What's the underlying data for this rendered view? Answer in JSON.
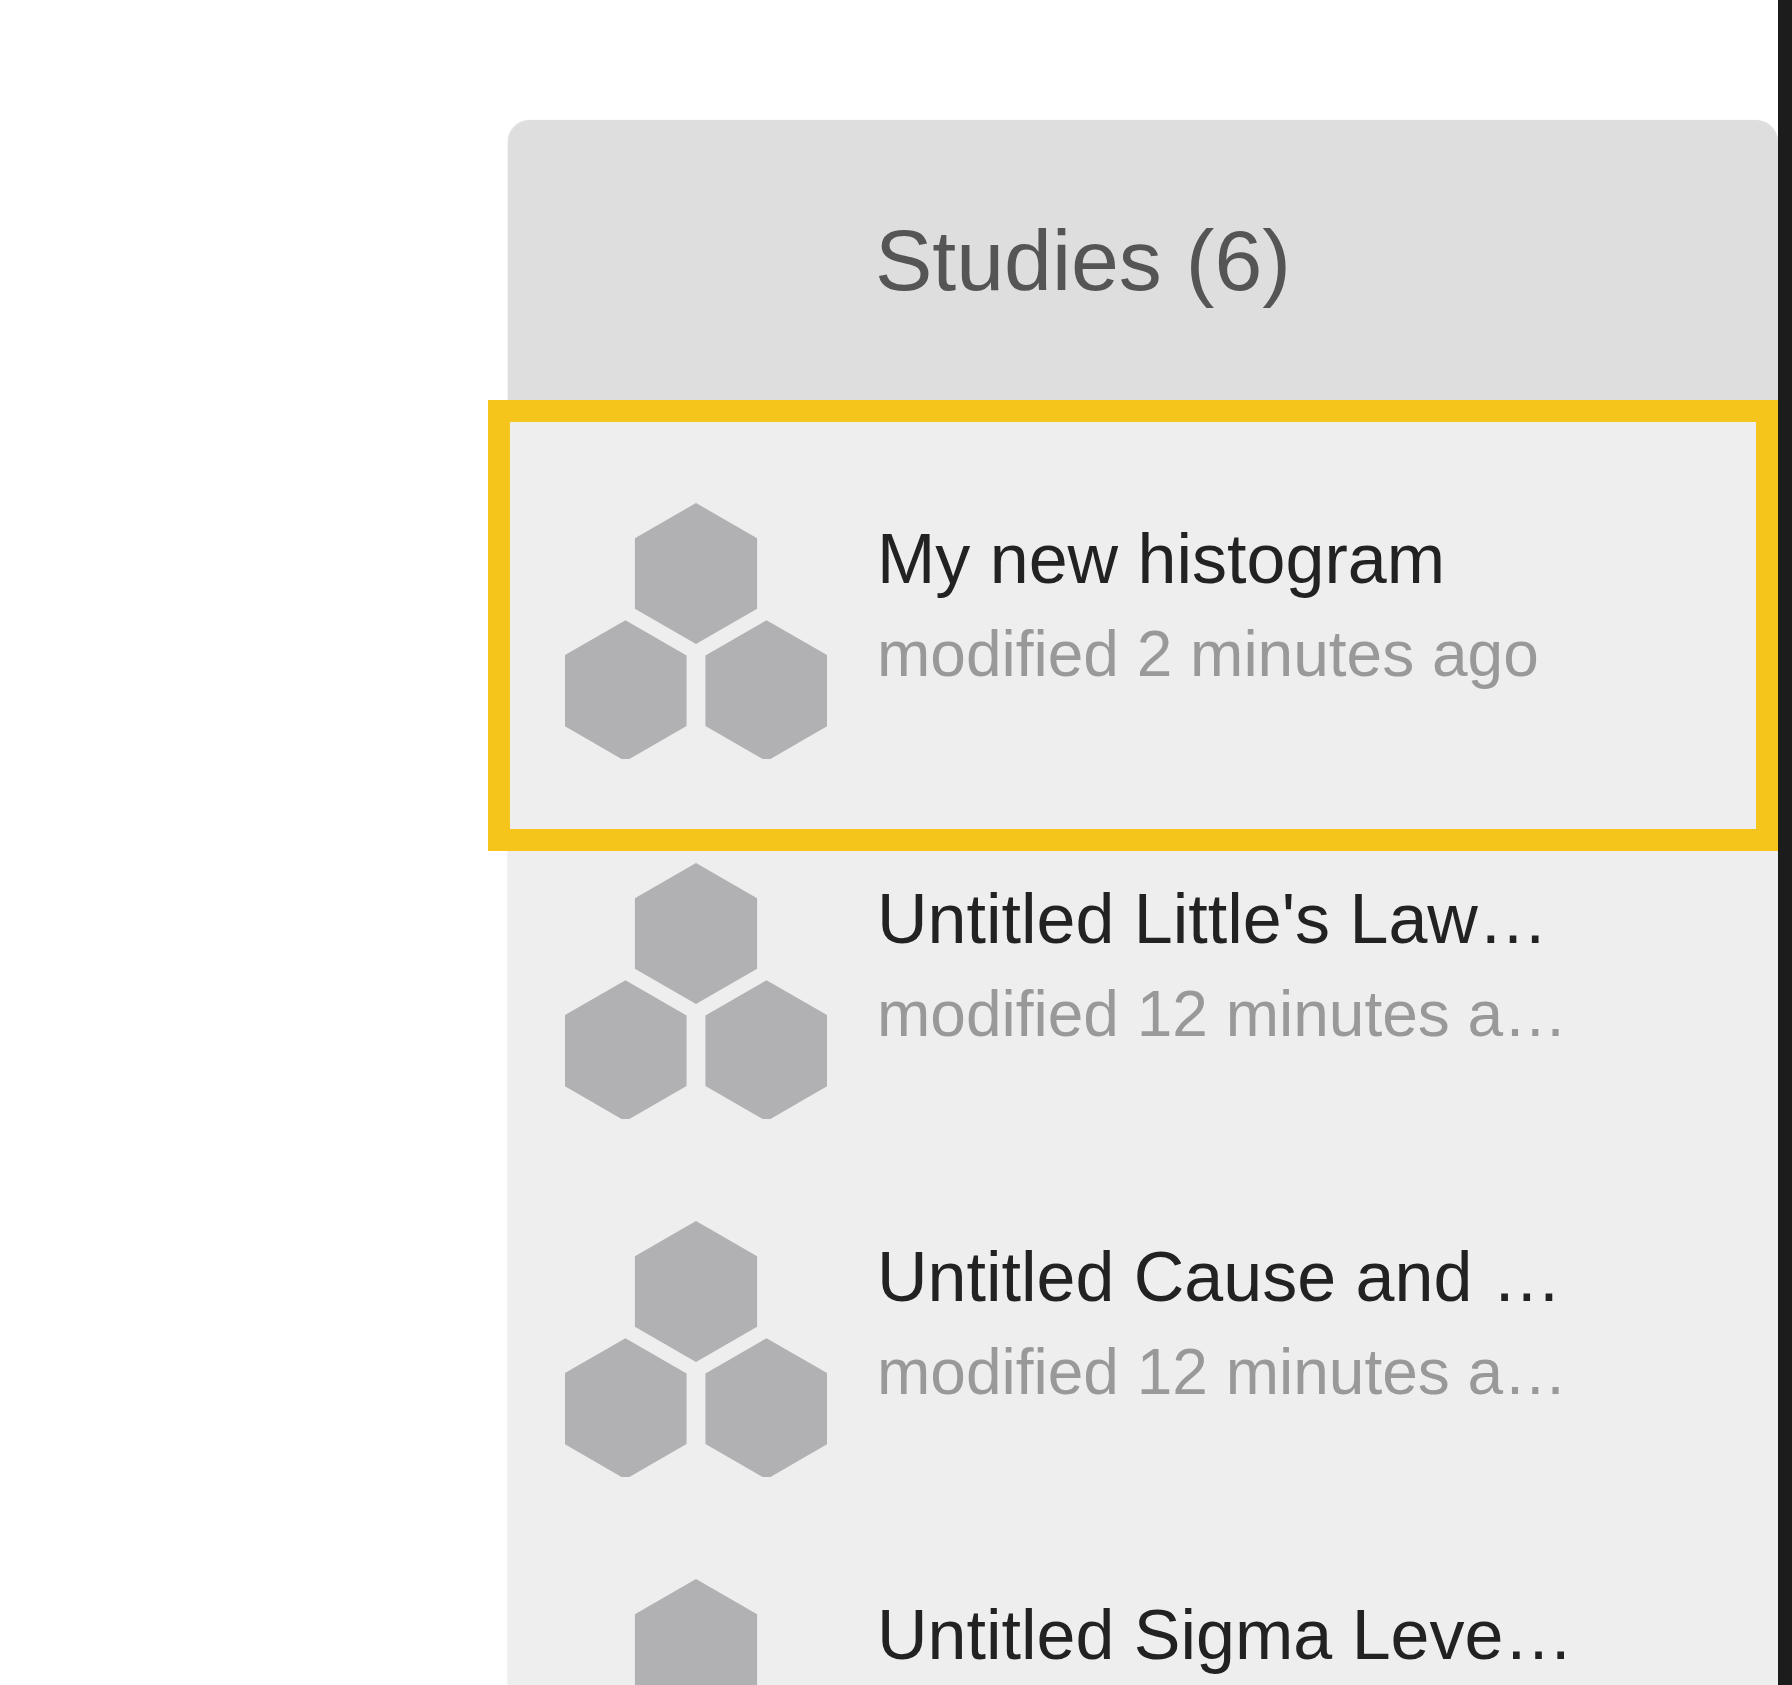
{
  "panel": {
    "title": "Studies (6)"
  },
  "studies": [
    {
      "title": "My new histogram",
      "subtitle": "modified 2 minutes ago",
      "selected": true
    },
    {
      "title": "Untitled Little's Law…",
      "subtitle": "modified 12 minutes a…",
      "selected": false
    },
    {
      "title": "Untitled Cause and …",
      "subtitle": "modified 12 minutes a…",
      "selected": false
    },
    {
      "title": "Untitled Sigma Leve…",
      "selected": false
    }
  ]
}
